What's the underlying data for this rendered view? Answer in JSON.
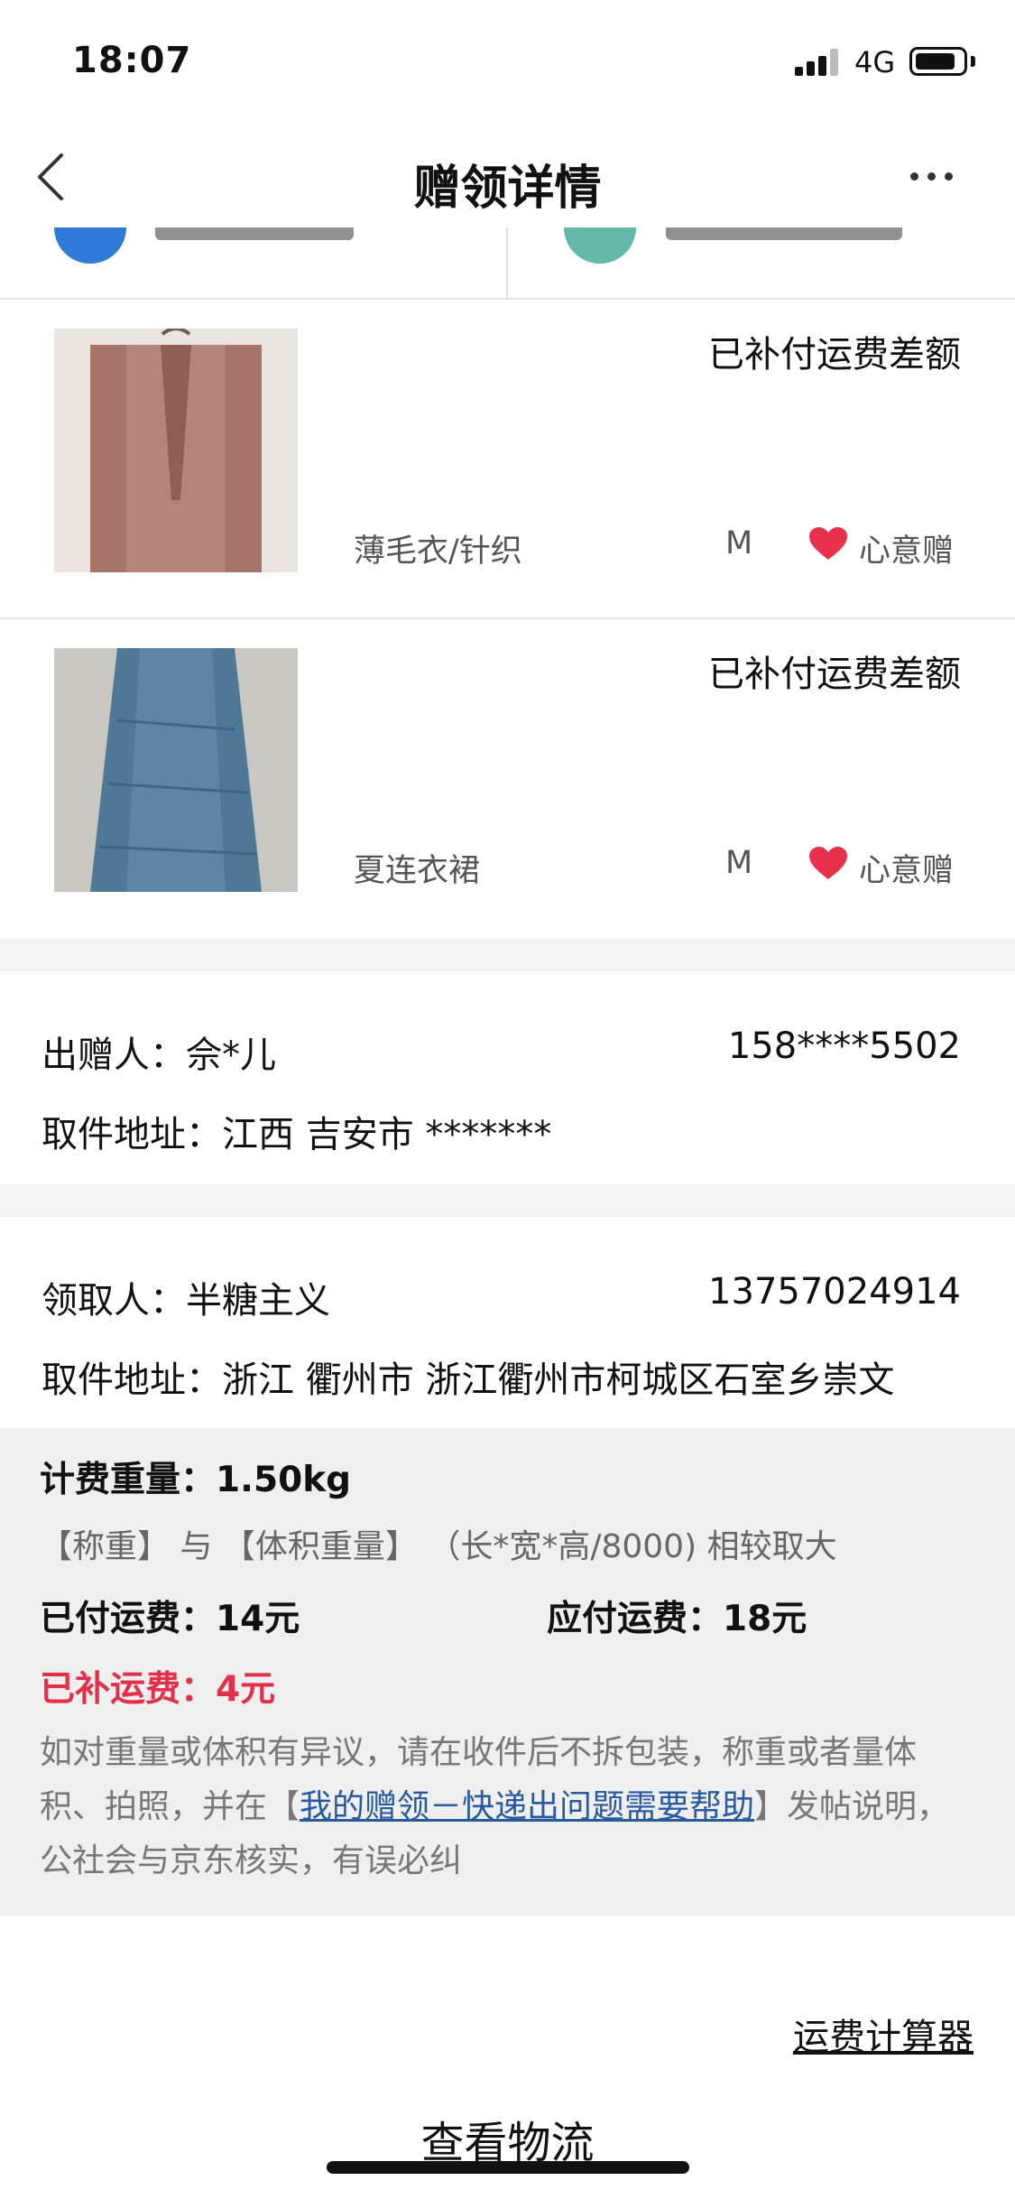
{
  "status_bar": {
    "time": "18:07",
    "network": "4G",
    "battery_level": 0.85
  },
  "nav": {
    "title": "赠领详情",
    "back_icon": "chevron-left-icon",
    "more_icon": "ellipsis-icon"
  },
  "items": [
    {
      "status": "已补付运费差额",
      "name": "薄毛衣/针织",
      "size": "M",
      "tag": "心意赠",
      "thumb_color": "#b58478"
    },
    {
      "status": "已补付运费差额",
      "name": "夏连衣裙",
      "size": "M",
      "tag": "心意赠",
      "thumb_color": "#4f7796"
    }
  ],
  "giver": {
    "label": "出赠人：",
    "name": "佘*儿",
    "phone": "158****5502",
    "address_label": "取件地址：",
    "address": "江西 吉安市 *******"
  },
  "receiver": {
    "label": "领取人：",
    "name": "半糖主义",
    "phone": "13757024914",
    "address_label": "取件地址：",
    "address": "浙江 衢州市 浙江衢州市柯城区石室乡崇文"
  },
  "shipping": {
    "weight_label": "计费重量：",
    "weight": "1.50kg",
    "note": "【称重】 与 【体积重量】 （长*宽*高/8000) 相较取大",
    "paid_label": "已付运费：",
    "paid": "14元",
    "due_label": "应付运费：",
    "due": "18元",
    "extra_label": "已补运费：",
    "extra": "4元",
    "desc_before": "如对重量或体积有异议，请在收件后不拆包装，称重或者量体积、拍照，并在【",
    "desc_link": "我的赠领－快递出问题需要帮助",
    "desc_after": "】发帖说明，公社会与京东核实，有误必纠"
  },
  "calculator_link": "运费计算器",
  "logistics_button": "查看物流",
  "colors": {
    "accent_red": "#e0304a",
    "link_blue": "#2a5a9e",
    "heart": "#e8324d"
  }
}
